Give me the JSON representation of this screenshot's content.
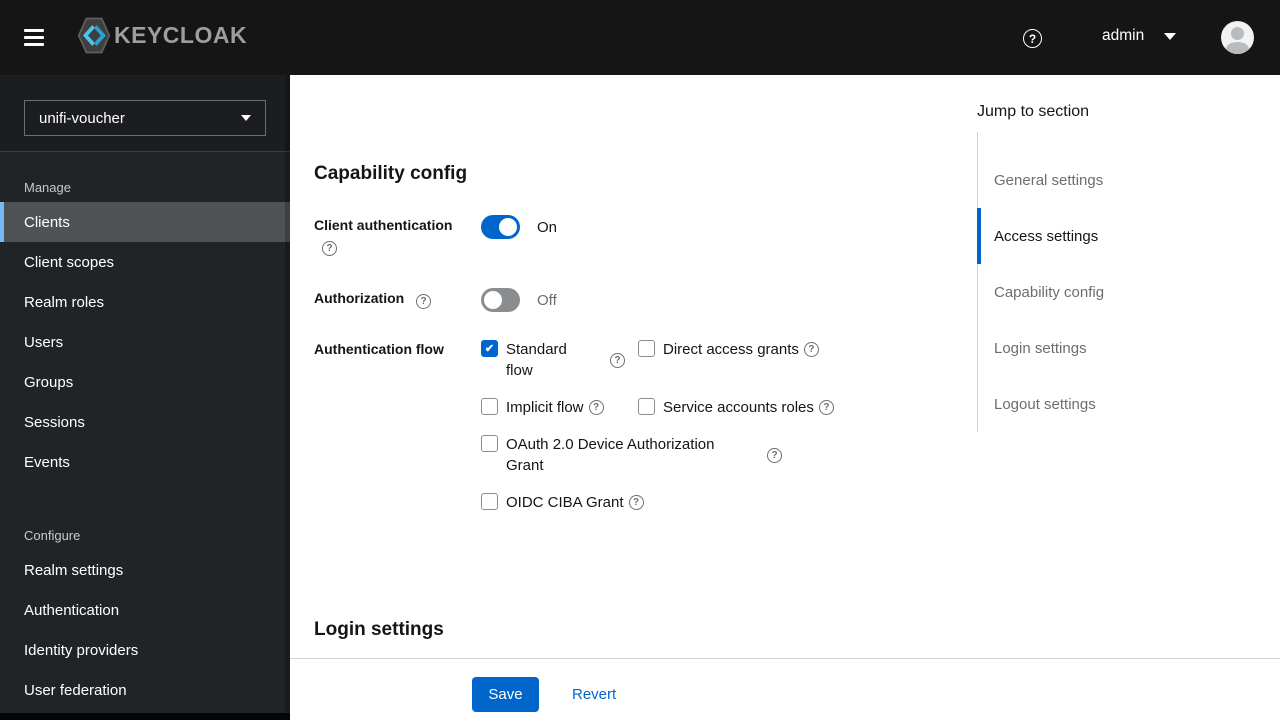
{
  "topbar": {
    "brand": "KEYCLOAK",
    "user": "admin"
  },
  "sidebar": {
    "realm": "unifi-voucher",
    "sections": [
      {
        "label": "Manage",
        "items": [
          {
            "label": "Clients",
            "selected": true
          },
          {
            "label": "Client scopes",
            "selected": false
          },
          {
            "label": "Realm roles",
            "selected": false
          },
          {
            "label": "Users",
            "selected": false
          },
          {
            "label": "Groups",
            "selected": false
          },
          {
            "label": "Sessions",
            "selected": false
          },
          {
            "label": "Events",
            "selected": false
          }
        ]
      },
      {
        "label": "Configure",
        "items": [
          {
            "label": "Realm settings",
            "selected": false
          },
          {
            "label": "Authentication",
            "selected": false
          },
          {
            "label": "Identity providers",
            "selected": false
          },
          {
            "label": "User federation",
            "selected": false
          }
        ]
      }
    ]
  },
  "main": {
    "capability": {
      "title": "Capability config",
      "client_auth": {
        "label": "Client authentication",
        "enabled": true,
        "state": "On"
      },
      "authorization": {
        "label": "Authorization",
        "enabled": false,
        "state": "Off"
      },
      "auth_flow": {
        "label": "Authentication flow",
        "options": [
          {
            "label": "Standard flow",
            "checked": true
          },
          {
            "label": "Direct access grants",
            "checked": false
          },
          {
            "label": "Implicit flow",
            "checked": false
          },
          {
            "label": "Service accounts roles",
            "checked": false
          },
          {
            "label": "OAuth 2.0 Device Authorization Grant",
            "checked": false
          },
          {
            "label": "OIDC CIBA Grant",
            "checked": false
          }
        ]
      }
    },
    "login_settings_title": "Login settings",
    "footer": {
      "save": "Save",
      "revert": "Revert"
    }
  },
  "jump": {
    "title": "Jump to section",
    "items": [
      {
        "label": "General settings",
        "active": false
      },
      {
        "label": "Access settings",
        "active": true
      },
      {
        "label": "Capability config",
        "active": false
      },
      {
        "label": "Login settings",
        "active": false
      },
      {
        "label": "Logout settings",
        "active": false
      }
    ]
  },
  "icons": {
    "help_glyph": "?",
    "check_glyph": "✔"
  },
  "colors": {
    "primary_blue": "#0066cc",
    "topbar_bg": "#151515",
    "sidebar_bg": "#212427",
    "nav_selected_bg": "#4f5255",
    "nav_selected_bar": "#73bcf7",
    "brand_chevron_light": "#4fc4ea",
    "brand_chevron_dark": "#2e9fcc",
    "toggle_off": "#8a8d90",
    "muted_text": "#6a6e73",
    "divider": "#d2d2d2"
  }
}
